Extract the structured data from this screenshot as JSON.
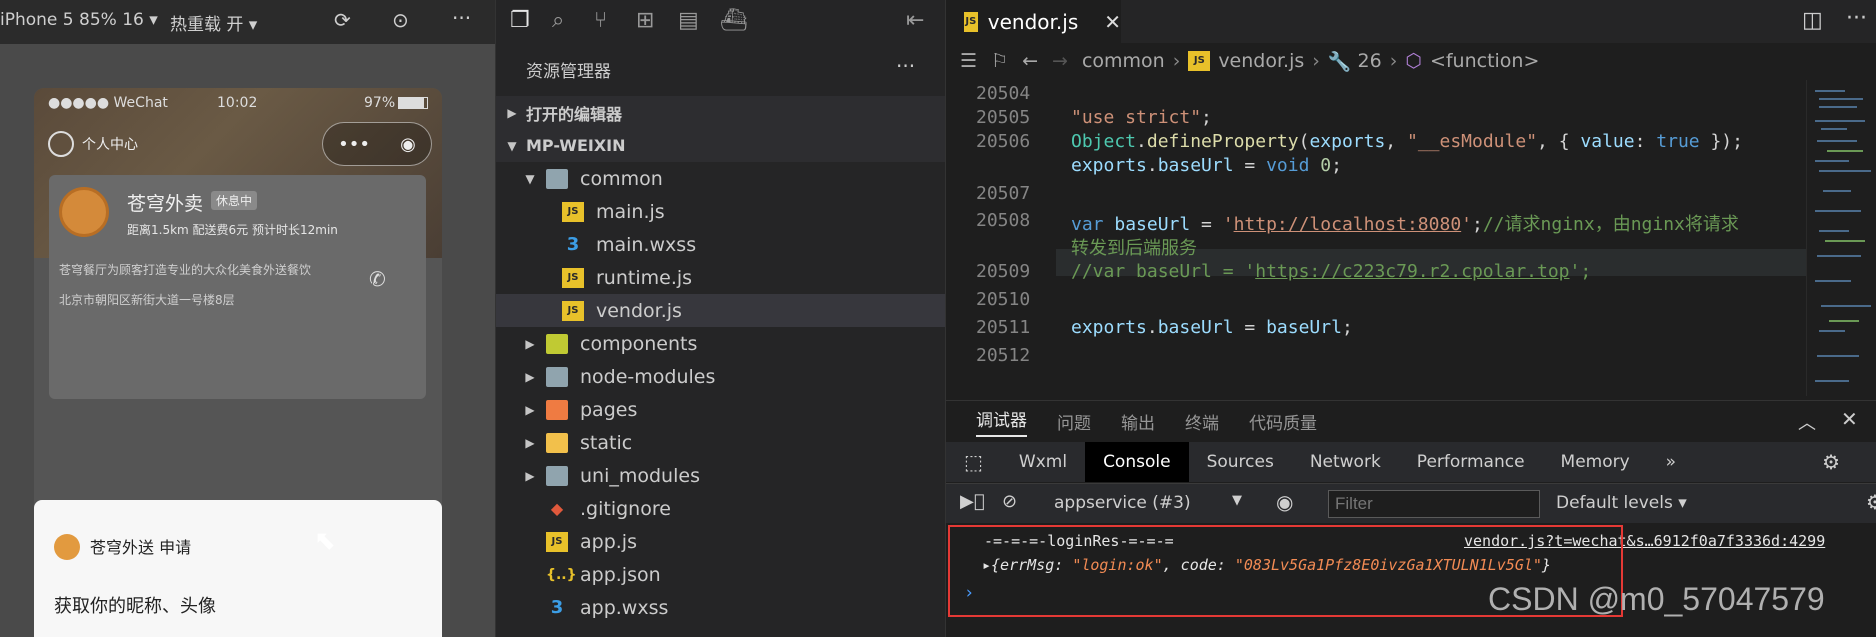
{
  "simulator": {
    "device": "iPhone 5 85% 16 ▾",
    "hot_reload": "热重载 开 ▾",
    "status": {
      "carrier": "●●●●● WeChat",
      "time": "10:02",
      "battery": "97%"
    },
    "personal_center": "个人中心",
    "shop": {
      "name": "苍穹外卖",
      "badge": "休息中",
      "meta": "距离1.5km  配送费6元  预计时长12min",
      "desc": "苍穹餐厅为顾客打造专业的大众化美食外送餐饮",
      "address": "北京市朝阳区新街大道一号楼8层"
    },
    "auth_sheet": {
      "title": "苍穹外送 申请",
      "text": "获取你的昵称、头像"
    }
  },
  "explorer": {
    "title": "资源管理器",
    "sections": {
      "open_editors": "打开的编辑器",
      "project": "MP-WEIXIN"
    },
    "tree": {
      "common": "common",
      "main_js": "main.js",
      "main_wxss": "main.wxss",
      "runtime_js": "runtime.js",
      "vendor_js": "vendor.js",
      "components": "components",
      "node_modules": "node-modules",
      "pages": "pages",
      "static": "static",
      "uni_modules": "uni_modules",
      "gitignore": ".gitignore",
      "app_js": "app.js",
      "app_json": "app.json",
      "app_wxss": "app.wxss"
    }
  },
  "editor": {
    "tab": "vendor.js",
    "breadcrumb": {
      "folder": "common",
      "file": "vendor.js",
      "num": "26",
      "fn": "<function>"
    },
    "lines": [
      "20504",
      "20505",
      "20506",
      "20507",
      "20508",
      "20509",
      "20510",
      "20511",
      "20512"
    ]
  },
  "panel": {
    "tabs": [
      "调试器",
      "问题",
      "输出",
      "终端",
      "代码质量"
    ],
    "devtools_tabs": [
      "Wxml",
      "Console",
      "Sources",
      "Network",
      "Performance",
      "Memory"
    ],
    "context": "appservice (#3)",
    "filter_placeholder": "Filter",
    "levels": "Default levels ▾"
  },
  "console": {
    "log1": "-=-=-=-loginRes-=-=-=",
    "log1_src": "vendor.js?t=wechat&s…6912f0a7f3336d:4299",
    "log2_open": "▸{errMsg: ",
    "log2_errmsg": "\"login:ok\"",
    "log2_mid": ", code: ",
    "log2_code": "\"083Lv5Ga1Pfz8E0ivzGa1XTULN1Lv5Gl\"",
    "log2_close": "}",
    "prompt": "›"
  },
  "watermark": "CSDN @m0_57047579",
  "colors": {
    "accent_red": "#e53935",
    "js_icon": "#e8c12a",
    "keyword": "#569cd6",
    "string": "#ce9178"
  }
}
